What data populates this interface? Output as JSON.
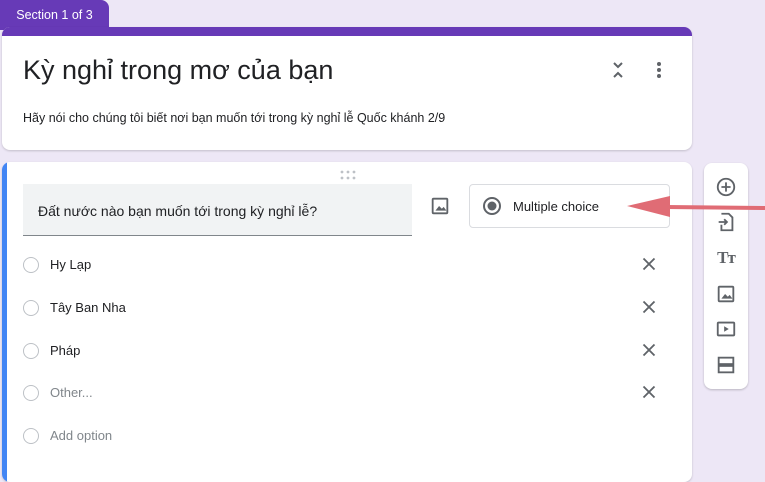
{
  "section": {
    "label": "Section 1 of 3"
  },
  "form": {
    "title": "Kỳ nghỉ trong mơ của bạn",
    "description": "Hãy nói cho chúng tôi biết nơi bạn muốn tới trong kỳ nghỉ lễ Quốc khánh 2/9"
  },
  "question": {
    "text": "Đất nước nào bạn muốn tới trong kỳ nghỉ lễ?",
    "type_label": "Multiple choice",
    "options": [
      {
        "label": "Hy Lạp"
      },
      {
        "label": "Tây Ban Nha"
      },
      {
        "label": "Pháp"
      },
      {
        "label": "Other..."
      }
    ],
    "add_option_label": "Add option"
  },
  "toolbar": {
    "items": [
      "add-question-icon",
      "import-questions-icon",
      "add-title-icon",
      "add-image-icon",
      "add-video-icon",
      "add-section-icon"
    ],
    "title_glyph": "Tт"
  },
  "colors": {
    "accent": "#673ab7",
    "active_border": "#4285f4",
    "background": "#ede7f6",
    "annotation_arrow": "#e06c75"
  }
}
